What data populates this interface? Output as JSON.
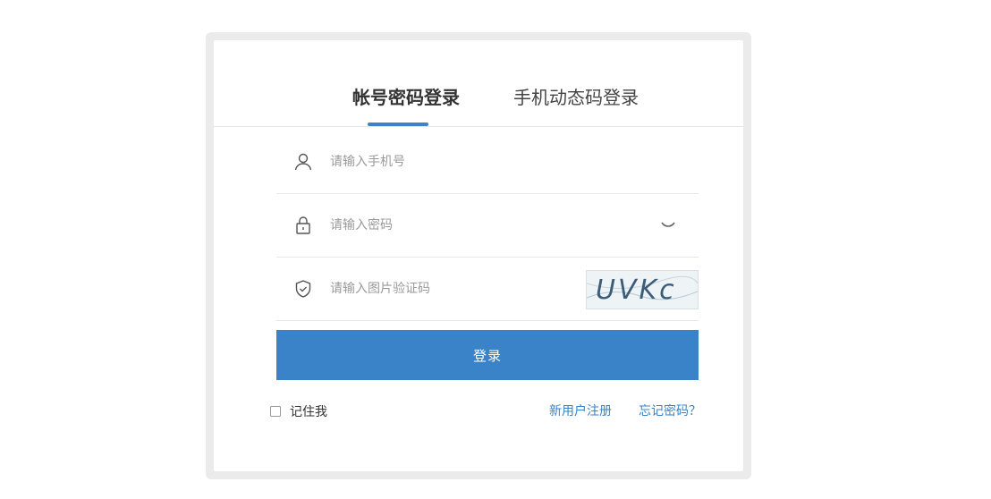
{
  "login": {
    "tabs": [
      {
        "label": "帐号密码登录",
        "active": true
      },
      {
        "label": "手机动态码登录",
        "active": false
      }
    ],
    "phone": {
      "placeholder": "请输入手机号",
      "value": ""
    },
    "password": {
      "placeholder": "请输入密码",
      "value": ""
    },
    "captcha": {
      "placeholder": "请输入图片验证码",
      "value": "",
      "image_text": "UVKc"
    },
    "submit_label": "登录",
    "remember_label": "记住我",
    "register_link": "新用户注册",
    "forgot_link": "忘记密码？"
  },
  "icons": {
    "phone_field": "user-icon",
    "password_field": "lock-icon",
    "captcha_field": "shield-check-icon",
    "password_toggle": "eye-closed-icon"
  },
  "colors": {
    "accent": "#3a83c9",
    "frame": "#ebebeb",
    "placeholder": "#9a9a9a"
  }
}
